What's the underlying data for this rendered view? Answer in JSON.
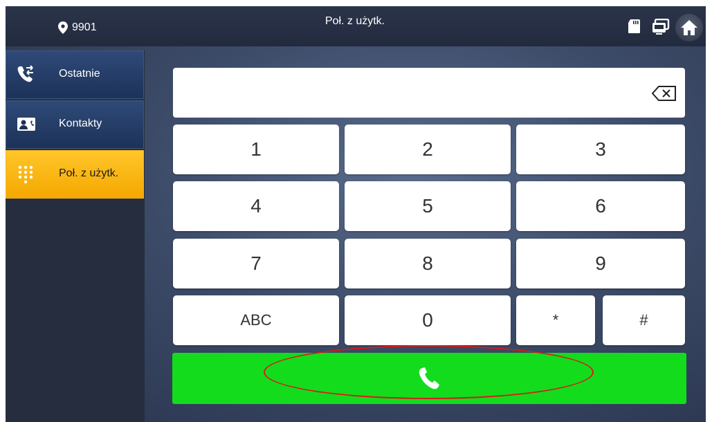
{
  "topbar": {
    "location_text": "9901",
    "title": "Poł. z użytk.",
    "icons": [
      "location-pin-icon",
      "sd-card-icon",
      "monitor-icon",
      "home-icon"
    ]
  },
  "sidebar": {
    "items": [
      {
        "label": "Ostatnie",
        "icon": "recent-calls-icon",
        "active": false
      },
      {
        "label": "Kontakty",
        "icon": "contacts-icon",
        "active": false
      },
      {
        "label": "Poł. z użytk.",
        "icon": "dialpad-icon",
        "active": true
      }
    ]
  },
  "dialer": {
    "input_value": "",
    "keys": [
      "1",
      "2",
      "3",
      "4",
      "5",
      "6",
      "7",
      "8",
      "9",
      "ABC",
      "0",
      "*",
      "#"
    ],
    "call_icon": "phone-handset-icon"
  },
  "colors": {
    "accent": "#f5a800",
    "call_button": "#13dc1d",
    "annotation": "#d91a1a"
  }
}
